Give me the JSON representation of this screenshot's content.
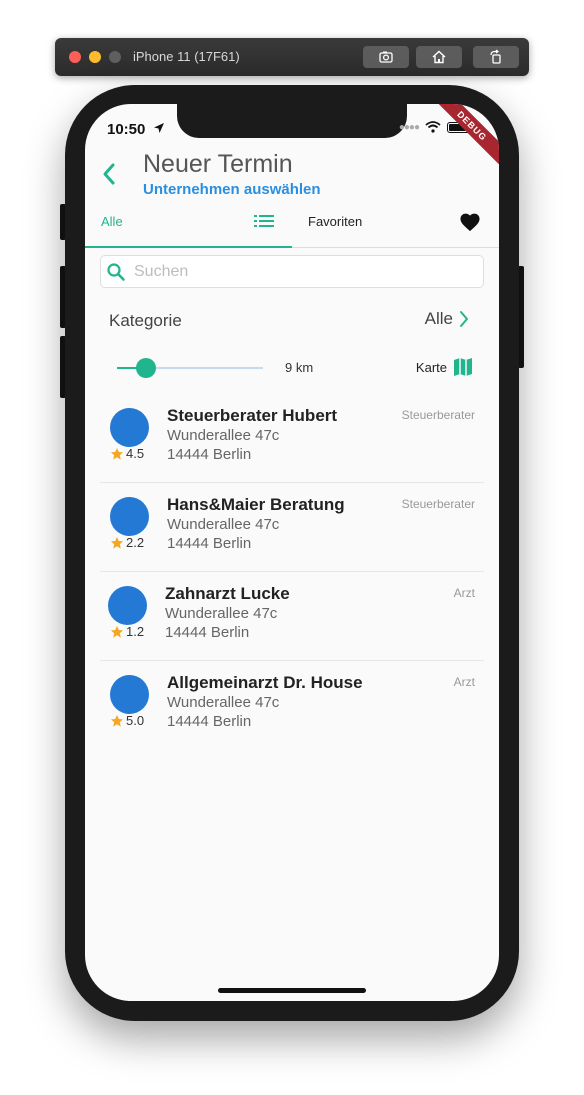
{
  "simulator": {
    "title": "iPhone 11 (17F61)"
  },
  "status": {
    "time": "10:50",
    "debug": "DEBUG"
  },
  "header": {
    "title": "Neuer Termin",
    "subtitle": "Unternehmen auswählen"
  },
  "tabs": [
    {
      "label": "Alle"
    },
    {
      "label": "Favoriten"
    }
  ],
  "search": {
    "placeholder": "Suchen",
    "value": ""
  },
  "category": {
    "label": "Kategorie",
    "value": "Alle"
  },
  "distance": {
    "label": "9 km",
    "slider_value_fraction": 0.2
  },
  "map": {
    "label": "Karte"
  },
  "colors": {
    "accent": "#21b58e",
    "subtitle": "#2a8fe0",
    "avatar": "#2479d4",
    "star": "#f5a623"
  },
  "companies": [
    {
      "name": "Steuerberater Hubert",
      "street": "Wunderallee 47c",
      "city": "14444 Berlin",
      "category": "Steuerberater",
      "rating": "4.5"
    },
    {
      "name": "Hans&Maier Beratung",
      "street": "Wunderallee 47c",
      "city": "14444 Berlin",
      "category": "Steuerberater",
      "rating": "2.2"
    },
    {
      "name": "Zahnarzt Lucke",
      "street": "Wunderallee 47c",
      "city": "14444 Berlin",
      "category": "Arzt",
      "rating": "1.2"
    },
    {
      "name": "Allgemeinarzt Dr. House",
      "street": "Wunderallee 47c",
      "city": "14444 Berlin",
      "category": "Arzt",
      "rating": "5.0"
    }
  ]
}
